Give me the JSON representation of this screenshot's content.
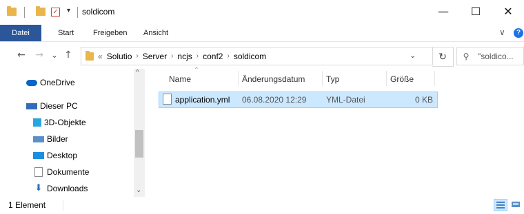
{
  "window": {
    "title": "soldicom",
    "minimize_glyph": "—",
    "maximize_glyph": "☐",
    "close_glyph": "✕"
  },
  "quick_access": {
    "dropdown_glyph": "▾",
    "check_glyph": "✓"
  },
  "ribbon": {
    "file_tab": "Datei",
    "tabs": [
      "Start",
      "Freigeben",
      "Ansicht"
    ],
    "expand_glyph": "∨",
    "help_glyph": "?"
  },
  "nav": {
    "back_glyph": "←",
    "forward_glyph": "→",
    "recent_glyph": "⌄",
    "up_glyph": "↑",
    "overflow": "«",
    "breadcrumbs": [
      "Solutio",
      "Server",
      "ncjs",
      "conf2",
      "soldicom"
    ],
    "crumb_sep": "›",
    "address_dropdown_glyph": "⌄",
    "refresh_glyph": "↻",
    "search_placeholder": "\"soldico...",
    "search_glyph": "⚲"
  },
  "sidebar": {
    "items": [
      {
        "label": "OneDrive",
        "icon": "onedrive-icon",
        "color": "#0a64c8"
      },
      {
        "label": "Dieser PC",
        "icon": "this-pc-icon",
        "color": "#2f6fb5"
      },
      {
        "label": "3D-Objekte",
        "icon": "3d-objects-icon",
        "color": "#2ba5e0"
      },
      {
        "label": "Bilder",
        "icon": "pictures-icon",
        "color": "#5a8fc7"
      },
      {
        "label": "Desktop",
        "icon": "desktop-icon",
        "color": "#1a8fe0"
      },
      {
        "label": "Dokumente",
        "icon": "documents-icon",
        "color": "#8a8a8a"
      },
      {
        "label": "Downloads",
        "icon": "downloads-icon",
        "color": "#2f6fb5"
      }
    ],
    "scroll_up_glyph": "^",
    "scroll_down_glyph": "⌄"
  },
  "columns": {
    "name": "Name",
    "date": "Änderungsdatum",
    "type": "Typ",
    "size": "Größe",
    "sort_glyph": "^"
  },
  "files": [
    {
      "name": "application.yml",
      "date": "06.08.2020 12:29",
      "type": "YML-Datei",
      "size": "0 KB"
    }
  ],
  "status": {
    "count": "1 Element"
  },
  "colors": {
    "accent": "#2b579a",
    "selection_bg": "#cce8ff",
    "selection_border": "#99d1ff",
    "folder": "#e8b64c"
  }
}
